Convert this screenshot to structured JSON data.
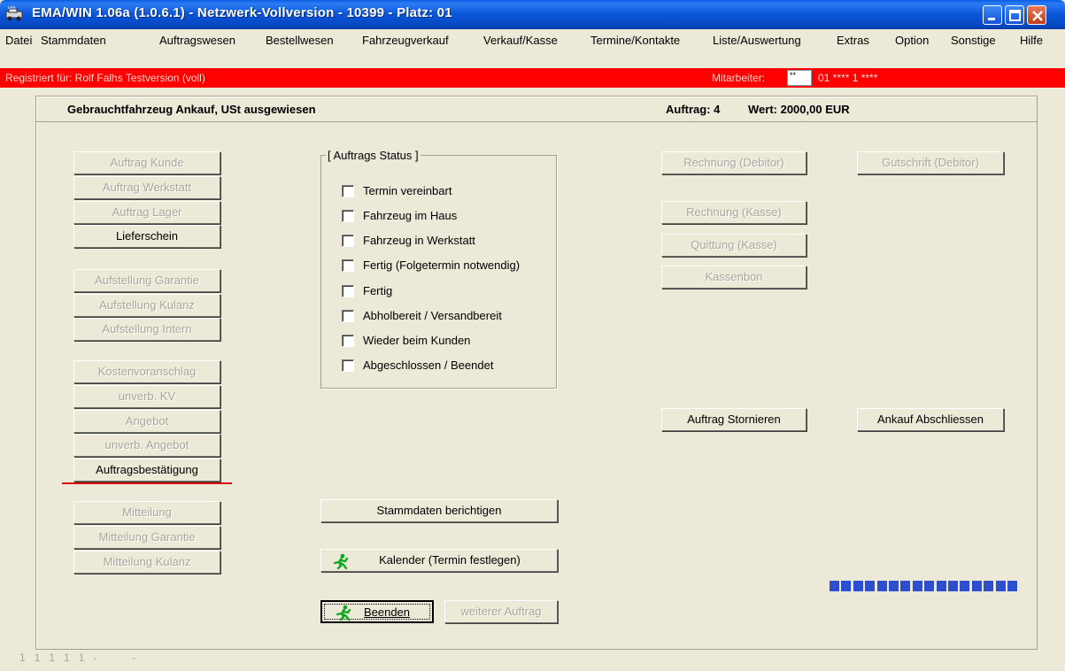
{
  "window": {
    "title": "EMA/WIN  1.06a (1.0.6.1) -  Netzwerk-Vollversion - 10399 - Platz: 01",
    "controls": [
      "minimize-icon",
      "maximize-icon",
      "close-icon"
    ]
  },
  "menu": [
    "Datei",
    "Stammdaten",
    "Auftragswesen",
    "Bestellwesen",
    "Fahrzeugverkauf",
    "Verkauf/Kasse",
    "Termine/Kontakte",
    "Liste/Auswertung",
    "Extras",
    "Option",
    "Sonstige",
    "Hilfe"
  ],
  "registration": {
    "text": "Registriert für: Rolf Falhs Testversion (voll)",
    "employee_label": "Mitarbeiter:",
    "employee_value": "**",
    "employee_number": "01  **** 1 ****"
  },
  "header": {
    "title": "Gebrauchtfahrzeug Ankauf, USt ausgewiesen",
    "order": "Auftrag: 4",
    "value": "Wert: 2000,00 EUR"
  },
  "left_buttons": {
    "group1": [
      {
        "label": "Auftrag Kunde",
        "enabled": false
      },
      {
        "label": "Auftrag Werkstatt",
        "enabled": false
      },
      {
        "label": "Auftrag Lager",
        "enabled": false
      },
      {
        "label": "Lieferschein",
        "enabled": true
      }
    ],
    "group2": [
      {
        "label": "Aufstellung Garantie",
        "enabled": false
      },
      {
        "label": "Aufstellung Kulanz",
        "enabled": false
      },
      {
        "label": "Aufstellung Intern",
        "enabled": false
      }
    ],
    "group3": [
      {
        "label": "Kostenvoranschlag",
        "enabled": false
      },
      {
        "label": "unverb. KV",
        "enabled": false
      },
      {
        "label": "Angebot",
        "enabled": false
      },
      {
        "label": "unverb. Angebot",
        "enabled": false
      },
      {
        "label": "Auftragsbestätigung",
        "enabled": true
      }
    ],
    "group4": [
      {
        "label": "Mitteilung",
        "enabled": false
      },
      {
        "label": "Mitteilung Garantie",
        "enabled": false
      },
      {
        "label": "Mitteilung Kulanz",
        "enabled": false
      }
    ]
  },
  "status": {
    "legend": "[ Auftrags Status ]",
    "items": [
      {
        "label": "Termin vereinbart",
        "checked": false
      },
      {
        "label": "Fahrzeug im Haus",
        "checked": false
      },
      {
        "label": "Fahrzeug in Werkstatt",
        "checked": false
      },
      {
        "label": "Fertig (Folgetermin notwendig)",
        "checked": false
      },
      {
        "label": "Fertig",
        "checked": false
      },
      {
        "label": "Abholbereit / Versandbereit",
        "checked": false
      },
      {
        "label": "Wieder beim Kunden",
        "checked": false
      },
      {
        "label": "Abgeschlossen / Beendet",
        "checked": false
      }
    ]
  },
  "center_buttons": {
    "stammdaten": "Stammdaten berichtigen",
    "kalender": "Kalender (Termin festlegen)",
    "beenden": "Beenden",
    "weiterer": "weiterer Auftrag"
  },
  "right_buttons": {
    "rechnung_debitor": "Rechnung (Debitor)",
    "gutschrift_debitor": "Gutschrift (Debitor)",
    "rechnung_kasse": "Rechnung (Kasse)",
    "quittung_kasse": "Quittung (Kasse)",
    "kassenbon": "Kassenbon",
    "stornieren": "Auftrag Stornieren",
    "abschliessen": "Ankauf Abschliessen"
  },
  "progress": {
    "filled_blocks": 16,
    "total_blocks": 16
  },
  "statusbar": "1   1   1   1   1   -            -",
  "colors": {
    "regbar": "#fe0000",
    "titlebar": "#0a5ce2",
    "progress": "#2d4fcf",
    "underline": "#e00000"
  }
}
